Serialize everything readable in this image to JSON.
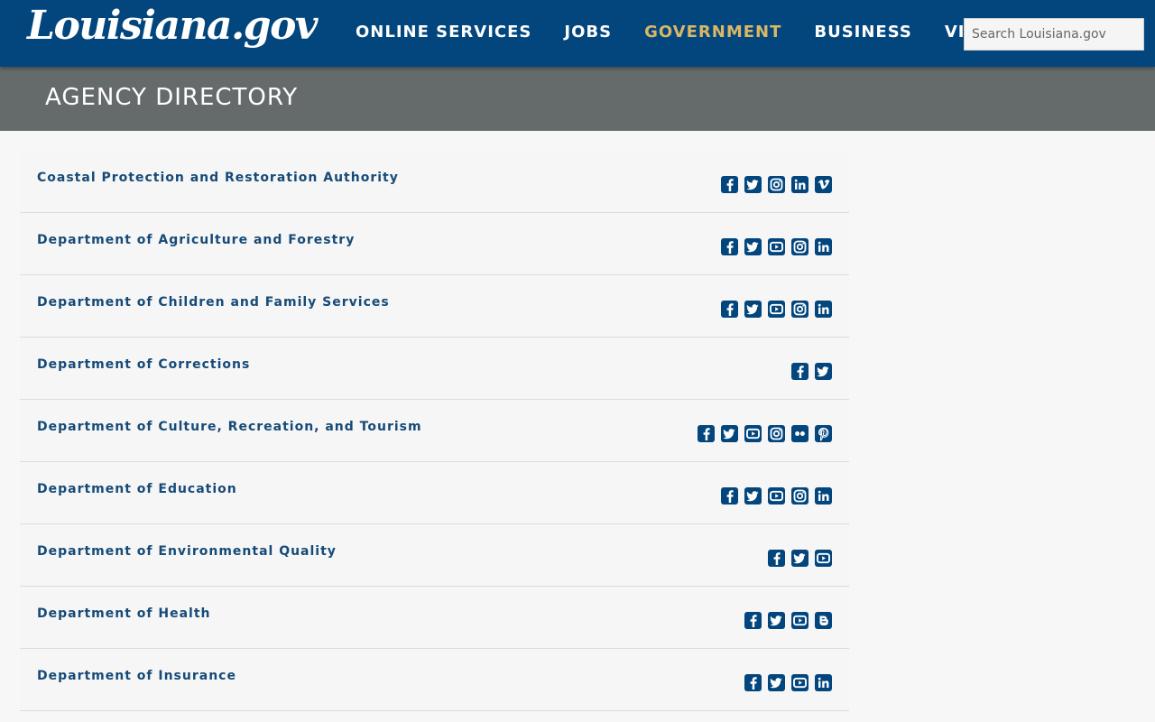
{
  "header": {
    "logo_text": "Louisiana.gov",
    "nav": [
      {
        "label": "ONLINE SERVICES",
        "active": false
      },
      {
        "label": "JOBS",
        "active": false
      },
      {
        "label": "GOVERNMENT",
        "active": true
      },
      {
        "label": "BUSINESS",
        "active": false
      },
      {
        "label": "VISIT",
        "active": false
      }
    ],
    "search_placeholder": "Search Louisiana.gov",
    "colors": {
      "bar": "#03467d",
      "active_nav": "#d9b766"
    }
  },
  "banner": {
    "title": "AGENCY DIRECTORY",
    "color": "#656b6b"
  },
  "agencies": [
    {
      "name": "Coastal Protection and Restoration Authority",
      "socials": [
        "facebook-icon",
        "twitter-icon",
        "instagram-icon",
        "linkedin-icon",
        "vimeo-icon"
      ]
    },
    {
      "name": "Department of Agriculture and Forestry",
      "socials": [
        "facebook-icon",
        "twitter-icon",
        "youtube-icon",
        "instagram-icon",
        "linkedin-icon"
      ]
    },
    {
      "name": "Department of Children and Family Services",
      "socials": [
        "facebook-icon",
        "twitter-icon",
        "youtube-icon",
        "instagram-icon",
        "linkedin-icon"
      ]
    },
    {
      "name": "Department of Corrections",
      "socials": [
        "facebook-icon",
        "twitter-icon"
      ]
    },
    {
      "name": "Department of Culture, Recreation, and Tourism",
      "socials": [
        "facebook-icon",
        "twitter-icon",
        "youtube-icon",
        "instagram-icon",
        "flickr-icon",
        "pinterest-icon"
      ]
    },
    {
      "name": "Department of Education",
      "socials": [
        "facebook-icon",
        "twitter-icon",
        "youtube-icon",
        "instagram-icon",
        "linkedin-icon"
      ]
    },
    {
      "name": "Department of Environmental Quality",
      "socials": [
        "facebook-icon",
        "twitter-icon",
        "youtube-icon"
      ]
    },
    {
      "name": "Department of Health",
      "socials": [
        "facebook-icon",
        "twitter-icon",
        "youtube-icon",
        "blogger-icon"
      ]
    },
    {
      "name": "Department of Insurance",
      "socials": [
        "facebook-icon",
        "twitter-icon",
        "youtube-icon",
        "linkedin-icon"
      ]
    }
  ]
}
